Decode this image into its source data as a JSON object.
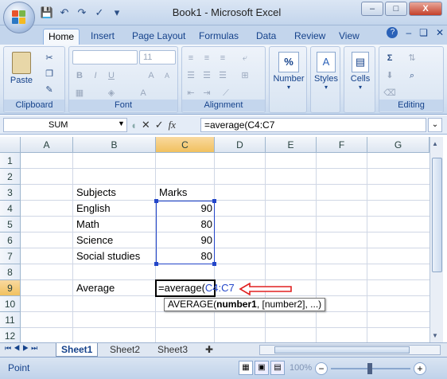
{
  "window": {
    "title": "Book1 - Microsoft Excel",
    "controls": [
      "–",
      "□",
      "X"
    ]
  },
  "quick_access": [
    "save-icon",
    "undo-icon",
    "redo-icon",
    "spelling-icon"
  ],
  "tabs": [
    "Home",
    "Insert",
    "Page Layout",
    "Formulas",
    "Data",
    "Review",
    "View"
  ],
  "ribbon": {
    "groups": [
      "Clipboard",
      "Font",
      "Alignment",
      "Number",
      "Styles",
      "Cells",
      "Editing"
    ],
    "paste_label": "Paste",
    "font_size": "11",
    "number_label": "Number",
    "styles_label": "Styles",
    "cells_label": "Cells"
  },
  "formula_bar": {
    "name_box": "SUM",
    "fx": "fx",
    "formula": "=average(C4:C7"
  },
  "grid": {
    "columns": [
      "A",
      "B",
      "C",
      "D",
      "E",
      "F",
      "G"
    ],
    "rows": [
      "1",
      "2",
      "3",
      "4",
      "5",
      "6",
      "7",
      "8",
      "9",
      "10",
      "11",
      "12"
    ],
    "cells": {
      "B3": "Subjects",
      "C3": "Marks",
      "B4": "English",
      "C4": "90",
      "B5": "Math",
      "C5": "80",
      "B6": "Science",
      "C6": "90",
      "B7": "Social studies",
      "C7": "80",
      "B9": "Average",
      "C9_prefix": "=average(",
      "C9_ref": "C4:C7"
    },
    "tooltip": {
      "func": "AVERAGE(",
      "arg1": "number1",
      "rest": ", [number2], ...)"
    }
  },
  "sheets": [
    "Sheet1",
    "Sheet2",
    "Sheet3"
  ],
  "status": {
    "mode": "Point",
    "zoom": "100%"
  },
  "colors": {
    "accent": "#15428b",
    "range_border": "#2346c9",
    "arrow": "#e02020"
  }
}
